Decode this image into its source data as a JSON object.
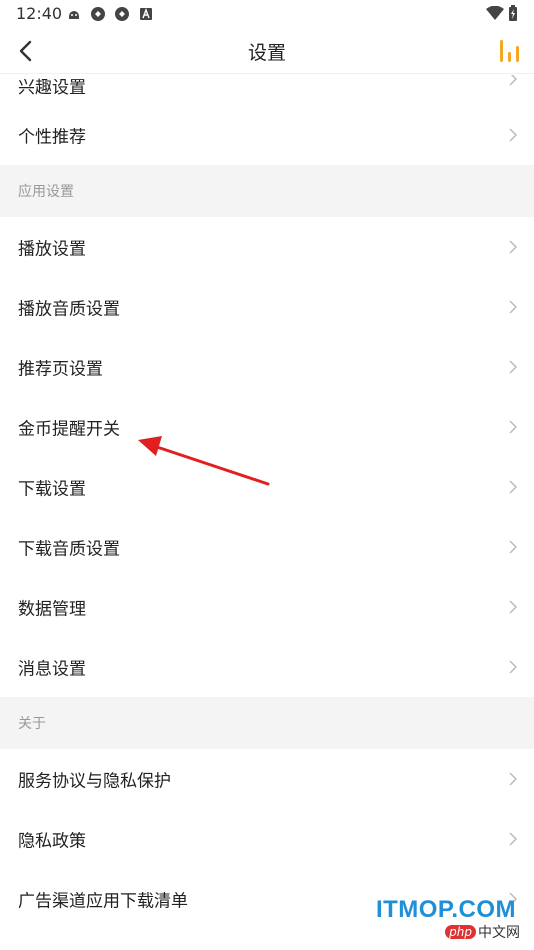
{
  "status": {
    "time": "12:40",
    "icons": [
      "android-debug-icon",
      "sync-icon",
      "sync-icon",
      "a-badge-icon"
    ],
    "right_icons": [
      "wifi-icon",
      "battery-charging-icon"
    ]
  },
  "header": {
    "title": "设置",
    "back_icon": "chevron-left-icon",
    "action_icon": "bar-chart-icon",
    "accent": "#f5a623"
  },
  "rows_top": [
    {
      "label": "兴趣设置"
    },
    {
      "label": "个性推荐"
    }
  ],
  "sections": [
    {
      "title": "应用设置",
      "items": [
        {
          "label": "播放设置"
        },
        {
          "label": "播放音质设置"
        },
        {
          "label": "推荐页设置"
        },
        {
          "label": "金币提醒开关"
        },
        {
          "label": "下载设置"
        },
        {
          "label": "下载音质设置"
        },
        {
          "label": "数据管理"
        },
        {
          "label": "消息设置"
        }
      ]
    },
    {
      "title": "关于",
      "items": [
        {
          "label": "服务协议与隐私保护"
        },
        {
          "label": "隐私政策"
        },
        {
          "label": "广告渠道应用下载清单"
        }
      ]
    }
  ],
  "watermark": {
    "main": "ITMOP.COM",
    "php": "php",
    "sub": "中文网"
  },
  "annotation_color": "#e02020"
}
